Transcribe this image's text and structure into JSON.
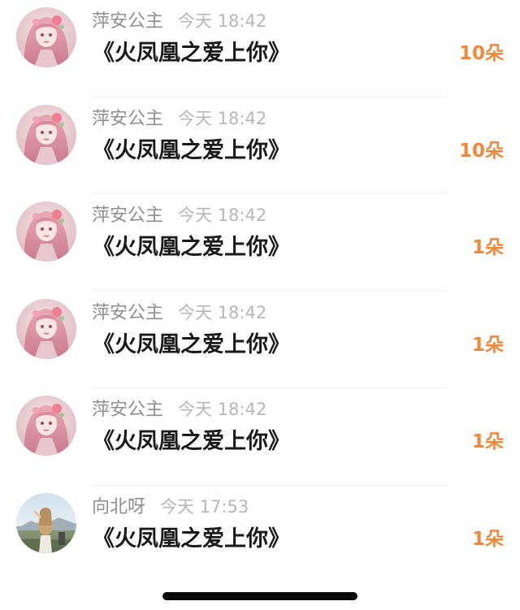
{
  "gifts": [
    {
      "name": "萍安公主",
      "time": "今天 18:42",
      "title": "《火凤凰之爱上你》",
      "count": "10朵",
      "avatar": "pink-hair-girl-avatar"
    },
    {
      "name": "萍安公主",
      "time": "今天 18:42",
      "title": "《火凤凰之爱上你》",
      "count": "10朵",
      "avatar": "pink-hair-girl-avatar"
    },
    {
      "name": "萍安公主",
      "time": "今天 18:42",
      "title": "《火凤凰之爱上你》",
      "count": "1朵",
      "avatar": "pink-hair-girl-avatar"
    },
    {
      "name": "萍安公主",
      "time": "今天 18:42",
      "title": "《火凤凰之爱上你》",
      "count": "1朵",
      "avatar": "pink-hair-girl-avatar"
    },
    {
      "name": "萍安公主",
      "time": "今天 18:42",
      "title": "《火凤凰之爱上你》",
      "count": "1朵",
      "avatar": "pink-hair-girl-avatar"
    },
    {
      "name": "向北呀",
      "time": "今天 17:53",
      "title": "《火凤凰之爱上你》",
      "count": "1朵",
      "avatar": "outdoor-photo-avatar"
    }
  ],
  "colors": {
    "accent_count": "#f0883a",
    "name": "#8e8e93",
    "time": "#b6b6bb",
    "title": "#1a1a1a"
  }
}
